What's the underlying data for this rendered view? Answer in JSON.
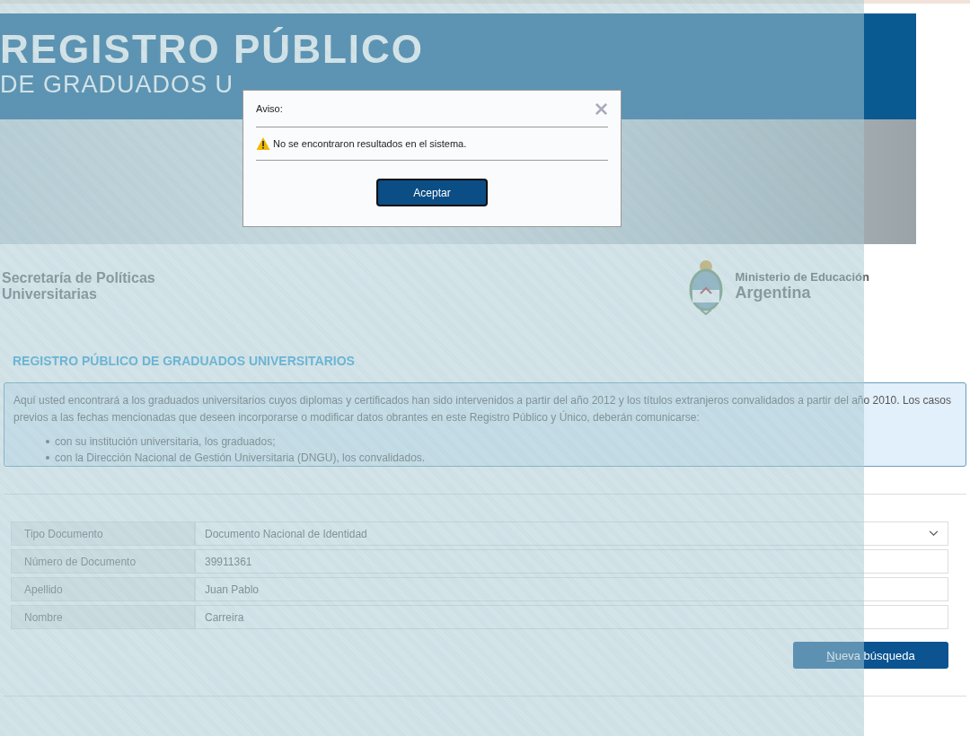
{
  "banner": {
    "title": "REGISTRO PÚBLICO",
    "subtitle": "DE GRADUADOS U"
  },
  "logos": {
    "secretaria": [
      "Secretaría de Políticas",
      "Universitarias"
    ],
    "ministerio": [
      "Ministerio de Educación",
      "Argentina"
    ]
  },
  "heading": "REGISTRO PÚBLICO DE GRADUADOS UNIVERSITARIOS",
  "info": {
    "text": "Aquí usted encontrará a los graduados universitarios cuyos diplomas y certificados han sido intervenidos a partir del año 2012 y los títulos extranjeros convalidados a partir del año 2010. Los casos previos a las fechas mencionadas que deseen incorporarse o modificar datos obrantes en este Registro Público y Único, deberán comunicarse:",
    "bullets": [
      "con su institución universitaria, los graduados;",
      "con la Dirección Nacional de Gestión Universitaria (DNGU), los convalidados."
    ]
  },
  "form": [
    {
      "label": "Tipo Documento",
      "value": "Documento Nacional de Identidad",
      "kind": "select"
    },
    {
      "label": "Número de Documento",
      "value": "39911361",
      "kind": "text"
    },
    {
      "label": "Apellido",
      "value": "Juan Pablo",
      "kind": "text"
    },
    {
      "label": "Nombre",
      "value": "Carreira",
      "kind": "text"
    }
  ],
  "search_button": "Nueva búsqueda",
  "dialog": {
    "title": "Aviso:",
    "message": "No se encontraron resultados en el sistema.",
    "button": "Aceptar"
  }
}
